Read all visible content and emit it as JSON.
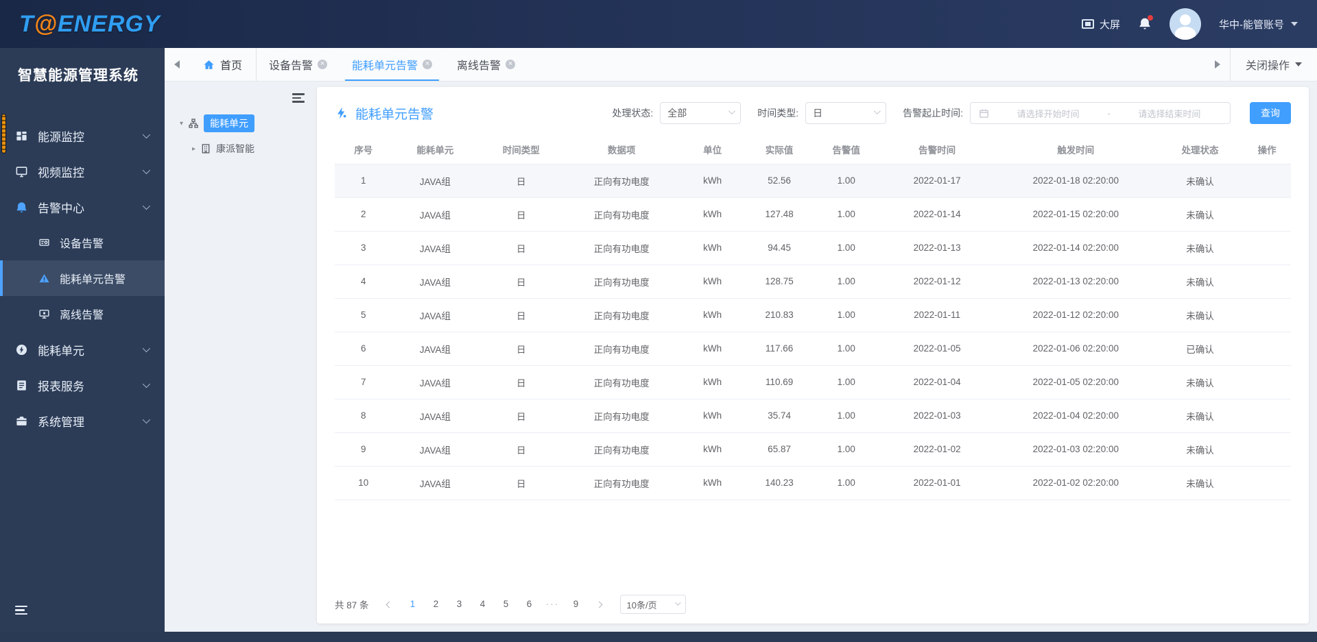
{
  "colors": {
    "accent": "#409eff",
    "topbar": "#243459",
    "sidebar": "#2c3c57",
    "logo_blue": "#2f9ef2",
    "logo_orange": "#f08519"
  },
  "topbar": {
    "logo_t": "T",
    "logo_at": "@",
    "logo_energy": "ENERGY",
    "bigscreen_label": "大屏",
    "account_label": "华中-能管账号"
  },
  "sidebar": {
    "title": "智慧能源管理系统",
    "items": [
      {
        "label": "能源监控"
      },
      {
        "label": "视频监控"
      },
      {
        "label": "告警中心",
        "children": [
          {
            "label": "设备告警"
          },
          {
            "label": "能耗单元告警",
            "active": true
          },
          {
            "label": "离线告警"
          }
        ]
      },
      {
        "label": "能耗单元"
      },
      {
        "label": "报表服务"
      },
      {
        "label": "系统管理"
      }
    ]
  },
  "tabbar": {
    "home_label": "首页",
    "tabs": [
      {
        "label": "设备告警"
      },
      {
        "label": "能耗单元告警",
        "active": true
      },
      {
        "label": "离线告警"
      }
    ],
    "close_ops_label": "关闭操作"
  },
  "tree": {
    "root_label": "能耗单元",
    "child_label": "康派智能"
  },
  "main": {
    "title": "能耗单元告警",
    "filters": {
      "status_label": "处理状态:",
      "status_value": "全部",
      "time_type_label": "时间类型:",
      "time_type_value": "日",
      "date_range_label": "告警起止时间:",
      "start_placeholder": "请选择开始时间",
      "separator": "-",
      "end_placeholder": "请选择结束时间",
      "search_label": "查询"
    },
    "table": {
      "columns": [
        "序号",
        "能耗单元",
        "时间类型",
        "数据项",
        "单位",
        "实际值",
        "告警值",
        "告警时间",
        "触发时间",
        "处理状态",
        "操作"
      ],
      "rows": [
        [
          "1",
          "JAVA组",
          "日",
          "正向有功电度",
          "kWh",
          "52.56",
          "1.00",
          "2022-01-17",
          "2022-01-18 02:20:00",
          "未确认",
          ""
        ],
        [
          "2",
          "JAVA组",
          "日",
          "正向有功电度",
          "kWh",
          "127.48",
          "1.00",
          "2022-01-14",
          "2022-01-15 02:20:00",
          "未确认",
          ""
        ],
        [
          "3",
          "JAVA组",
          "日",
          "正向有功电度",
          "kWh",
          "94.45",
          "1.00",
          "2022-01-13",
          "2022-01-14 02:20:00",
          "未确认",
          ""
        ],
        [
          "4",
          "JAVA组",
          "日",
          "正向有功电度",
          "kWh",
          "128.75",
          "1.00",
          "2022-01-12",
          "2022-01-13 02:20:00",
          "未确认",
          ""
        ],
        [
          "5",
          "JAVA组",
          "日",
          "正向有功电度",
          "kWh",
          "210.83",
          "1.00",
          "2022-01-11",
          "2022-01-12 02:20:00",
          "未确认",
          ""
        ],
        [
          "6",
          "JAVA组",
          "日",
          "正向有功电度",
          "kWh",
          "117.66",
          "1.00",
          "2022-01-05",
          "2022-01-06 02:20:00",
          "已确认",
          ""
        ],
        [
          "7",
          "JAVA组",
          "日",
          "正向有功电度",
          "kWh",
          "110.69",
          "1.00",
          "2022-01-04",
          "2022-01-05 02:20:00",
          "未确认",
          ""
        ],
        [
          "8",
          "JAVA组",
          "日",
          "正向有功电度",
          "kWh",
          "35.74",
          "1.00",
          "2022-01-03",
          "2022-01-04 02:20:00",
          "未确认",
          ""
        ],
        [
          "9",
          "JAVA组",
          "日",
          "正向有功电度",
          "kWh",
          "65.87",
          "1.00",
          "2022-01-02",
          "2022-01-03 02:20:00",
          "未确认",
          ""
        ],
        [
          "10",
          "JAVA组",
          "日",
          "正向有功电度",
          "kWh",
          "140.23",
          "1.00",
          "2022-01-01",
          "2022-01-02 02:20:00",
          "未确认",
          ""
        ]
      ]
    },
    "pagination": {
      "total_text": "共 87 条",
      "pages": [
        "1",
        "2",
        "3",
        "4",
        "5",
        "6",
        "···",
        "9"
      ],
      "active_page": "1",
      "page_size_value": "10条/页"
    }
  }
}
